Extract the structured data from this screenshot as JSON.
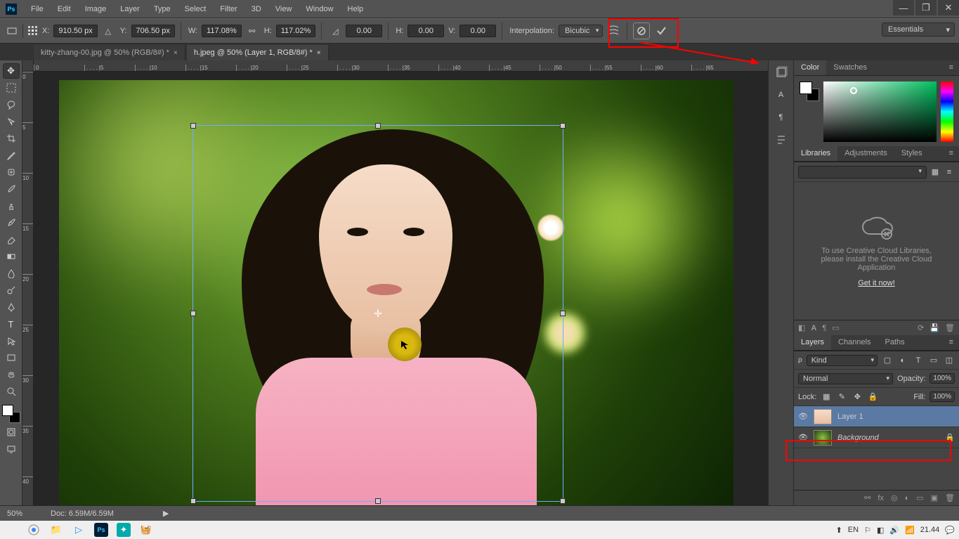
{
  "menu": [
    "File",
    "Edit",
    "Image",
    "Layer",
    "Type",
    "Select",
    "Filter",
    "3D",
    "View",
    "Window",
    "Help"
  ],
  "options": {
    "x_label": "X:",
    "x": "910.50 px",
    "y_label": "Y:",
    "y": "706.50 px",
    "w_label": "W:",
    "w": "117.08%",
    "h_label": "H:",
    "h": "117.02%",
    "rot": "0.00",
    "hsk_label": "H:",
    "hsk": "0.00",
    "vsk_label": "V:",
    "vsk": "0.00",
    "interp_label": "Interpolation:",
    "interp": "Bicubic"
  },
  "workspace": "Essentials",
  "tabs": [
    {
      "title": "kitty-zhang-00.jpg @ 50% (RGB/8#) *"
    },
    {
      "title": "h.jpeg @ 50% (Layer 1, RGB/8#) *"
    }
  ],
  "ruler_h": [
    "0",
    ". . . . |5",
    ". . . . |10",
    ". . . . |15",
    ". . . . |20",
    ". . . . |25",
    ". . . . |30",
    ". . . . |35",
    ". . . . |40",
    ". . . . |45",
    ". . . . |50",
    ". . . . |55",
    ". . . . |60",
    ". . . . |65"
  ],
  "ruler_v": [
    "0",
    "5",
    "10",
    "15",
    "20",
    "25",
    "30",
    "35",
    "40"
  ],
  "status": {
    "zoom": "50%",
    "doc": "Doc: 6.59M/6.59M"
  },
  "panels": {
    "color_tabs": [
      "Color",
      "Swatches"
    ],
    "lib_tabs": [
      "Libraries",
      "Adjustments",
      "Styles"
    ],
    "cc_text1": "To use Creative Cloud Libraries,",
    "cc_text2": "please install the Creative Cloud",
    "cc_text3": "Application",
    "cc_link": "Get it now!",
    "layer_tabs": [
      "Layers",
      "Channels",
      "Paths"
    ],
    "kind": "Kind",
    "blend": "Normal",
    "opacity_label": "Opacity:",
    "opacity": "100%",
    "lock_label": "Lock:",
    "fill_label": "Fill:",
    "fill": "100%",
    "layers": [
      {
        "name": "Layer 1",
        "locked": false
      },
      {
        "name": "Background",
        "locked": true
      }
    ]
  },
  "tray": {
    "lang": "EN",
    "time": "21.44"
  }
}
